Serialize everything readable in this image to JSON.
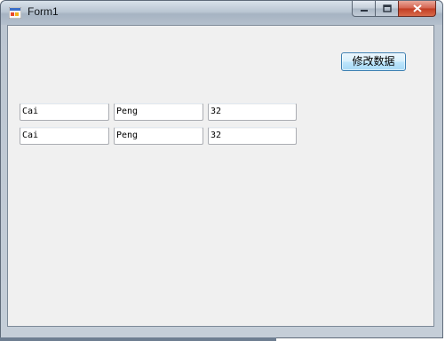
{
  "window": {
    "title": "Form1",
    "icons": {
      "app": "form-app-icon",
      "minimize": "minimize-icon",
      "maximize": "maximize-icon",
      "close": "close-icon"
    }
  },
  "form": {
    "modify_button_label": "修改数据",
    "rows": [
      {
        "first": "Cai",
        "last": "Peng",
        "age": "32"
      },
      {
        "first": "Cai",
        "last": "Peng",
        "age": "32"
      }
    ]
  },
  "colors": {
    "client_background": "#f0f0f0",
    "button_border": "#3c7fb1",
    "close_button": "#c13b22"
  }
}
